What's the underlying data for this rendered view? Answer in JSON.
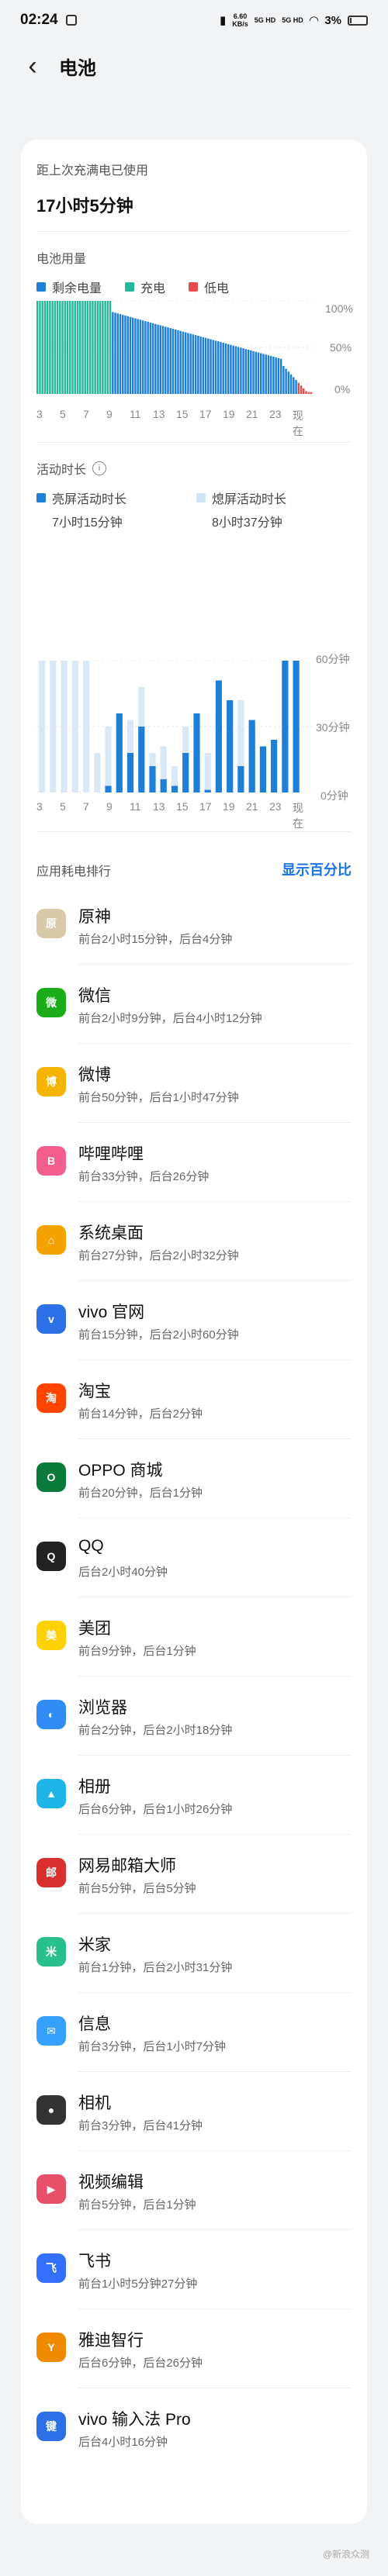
{
  "status": {
    "time": "02:24",
    "net1": "6.60",
    "net1_unit": "KB/s",
    "sig1": "5G HD",
    "sig2": "5G HD",
    "battery": "3%"
  },
  "header": {
    "title": "电池"
  },
  "summary": {
    "label": "距上次充满电已使用",
    "value": "17小时5分钟"
  },
  "usage": {
    "title": "电池用量",
    "legend": [
      {
        "label": "剩余电量",
        "color": "#1e7fd8"
      },
      {
        "label": "充电",
        "color": "#26b89a"
      },
      {
        "label": "低电",
        "color": "#e64a4a"
      }
    ],
    "yticks": [
      "100%",
      "50%",
      "0%"
    ],
    "xticks": [
      "3",
      "5",
      "7",
      "9",
      "11",
      "13",
      "15",
      "17",
      "19",
      "21",
      "23",
      "现在"
    ]
  },
  "activity": {
    "title": "活动时长",
    "screen_on_label": "亮屏活动时长",
    "screen_on_value": "7小时15分钟",
    "screen_off_label": "熄屏活动时长",
    "screen_off_value": "8小时37分钟",
    "yticks": [
      "60分钟",
      "30分钟",
      "0分钟"
    ],
    "xticks": [
      "3",
      "5",
      "7",
      "9",
      "11",
      "13",
      "15",
      "17",
      "19",
      "21",
      "23",
      "现在"
    ]
  },
  "ranking": {
    "title": "应用耗电排行",
    "show_percent": "显示百分比",
    "apps": [
      {
        "name": "原神",
        "detail": "前台2小时15分钟，后台4分钟",
        "icon": "原",
        "color": "#d8c9a8"
      },
      {
        "name": "微信",
        "detail": "前台2小时9分钟，后台4小时12分钟",
        "icon": "微",
        "color": "#1aad19"
      },
      {
        "name": "微博",
        "detail": "前台50分钟，后台1小时47分钟",
        "icon": "博",
        "color": "#f5b400"
      },
      {
        "name": "哔哩哔哩",
        "detail": "前台33分钟，后台26分钟",
        "icon": "B",
        "color": "#f25d8e"
      },
      {
        "name": "系统桌面",
        "detail": "前台27分钟，后台2小时32分钟",
        "icon": "⌂",
        "color": "#f4a300"
      },
      {
        "name": "vivo 官网",
        "detail": "前台15分钟，后台2小时60分钟",
        "icon": "v",
        "color": "#2d6fe6"
      },
      {
        "name": "淘宝",
        "detail": "前台14分钟，后台2分钟",
        "icon": "淘",
        "color": "#ff4400"
      },
      {
        "name": "OPPO 商城",
        "detail": "前台20分钟，后台1分钟",
        "icon": "O",
        "color": "#0a7a3a"
      },
      {
        "name": "QQ",
        "detail": "后台2小时40分钟",
        "icon": "Q",
        "color": "#222222"
      },
      {
        "name": "美团",
        "detail": "前台9分钟，后台1分钟",
        "icon": "美",
        "color": "#ffd100"
      },
      {
        "name": "浏览器",
        "detail": "前台2分钟，后台2小时18分钟",
        "icon": "◐",
        "color": "#2f8df5"
      },
      {
        "name": "相册",
        "detail": "后台6分钟，后台1小时26分钟",
        "icon": "▲",
        "color": "#1fb5e8"
      },
      {
        "name": "网易邮箱大师",
        "detail": "前台5分钟，后台5分钟",
        "icon": "邮",
        "color": "#d92f2f"
      },
      {
        "name": "米家",
        "detail": "前台1分钟，后台2小时31分钟",
        "icon": "米",
        "color": "#28c08c"
      },
      {
        "name": "信息",
        "detail": "前台3分钟，后台1小时7分钟",
        "icon": "✉",
        "color": "#36a0ff"
      },
      {
        "name": "相机",
        "detail": "前台3分钟，后台41分钟",
        "icon": "●",
        "color": "#333333"
      },
      {
        "name": "视频编辑",
        "detail": "前台5分钟，后台1分钟",
        "icon": "▶",
        "color": "#e8506a"
      },
      {
        "name": "飞书",
        "detail": "前台1小时5分钟27分钟",
        "icon": "飞",
        "color": "#3370ff"
      },
      {
        "name": "雅迪智行",
        "detail": "后台6分钟，后台26分钟",
        "icon": "Y",
        "color": "#f08a00"
      },
      {
        "name": "vivo 输入法 Pro",
        "detail": "后台4小时16分钟",
        "icon": "键",
        "color": "#2d6fe6"
      }
    ]
  },
  "watermark": "@新浪众测"
}
